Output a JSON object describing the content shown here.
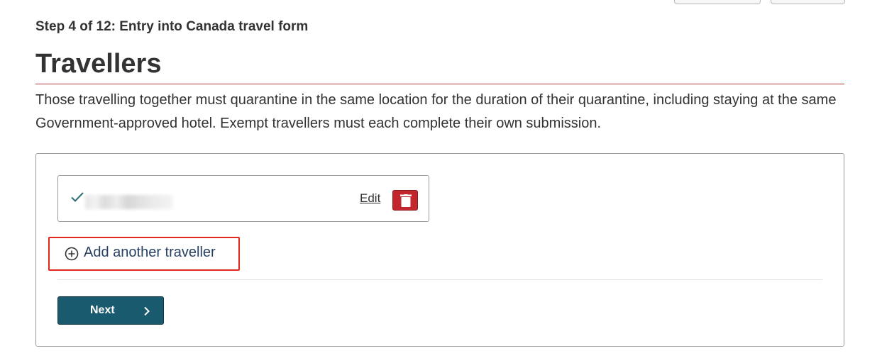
{
  "header": {
    "step_label": "Step 4 of 12: Entry into Canada travel form",
    "title": "Travellers",
    "intro": "Those travelling together must quarantine in the same location for the duration of their quarantine, including staying at the same Government-approved hotel. Exempt travellers must each complete their own submission."
  },
  "travellers": [
    {
      "status_icon": "check-icon",
      "name": "",
      "edit_label": "Edit",
      "delete_icon": "trash-icon"
    }
  ],
  "actions": {
    "add_label": "Add another traveller",
    "add_icon": "plus-circle-icon",
    "next_label": "Next",
    "next_icon": "chevron-right-icon"
  },
  "colors": {
    "accent_rule": "#af3c43",
    "link_text": "#284162",
    "delete_button": "#c1272d",
    "next_button": "#1a5a6e",
    "highlight_box": "#e0261d",
    "check": "#2c6d71"
  }
}
